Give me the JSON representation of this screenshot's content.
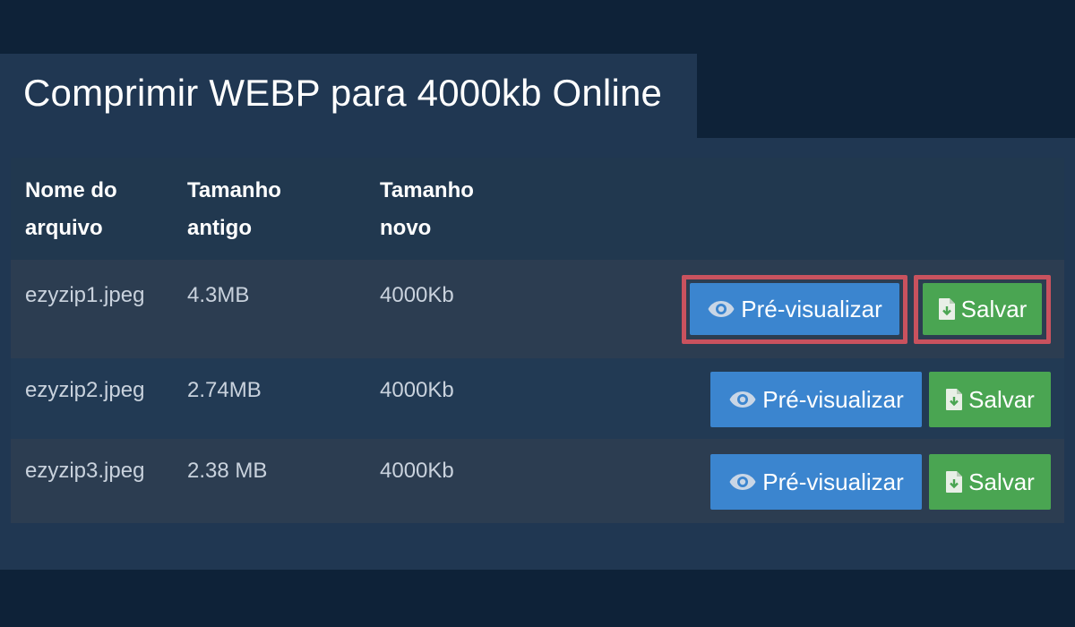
{
  "header": {
    "title": "Comprimir WEBP para 4000kb Online"
  },
  "table": {
    "columns": [
      {
        "line1": "Nome do",
        "line2": "arquivo"
      },
      {
        "line1": "Tamanho",
        "line2": "antigo"
      },
      {
        "line1": "Tamanho",
        "line2": "novo"
      }
    ],
    "rows": [
      {
        "filename": "ezyzip1.jpeg",
        "old_size": "4.3MB",
        "new_size": "4000Kb",
        "preview_label": "Pré-visualizar",
        "save_label": "Salvar",
        "highlighted": true
      },
      {
        "filename": "ezyzip2.jpeg",
        "old_size": "2.74MB",
        "new_size": "4000Kb",
        "preview_label": "Pré-visualizar",
        "save_label": "Salvar",
        "highlighted": false
      },
      {
        "filename": "ezyzip3.jpeg",
        "old_size": "2.38 MB",
        "new_size": "4000Kb",
        "preview_label": "Pré-visualizar",
        "save_label": "Salvar",
        "highlighted": false
      }
    ]
  },
  "colors": {
    "background": "#0e2238",
    "panel": "#203752",
    "preview_button": "#3b85cf",
    "save_button": "#4aa552",
    "highlight_border": "#c9525e"
  },
  "icons": {
    "preview": "eye-icon",
    "save": "file-download-icon"
  }
}
